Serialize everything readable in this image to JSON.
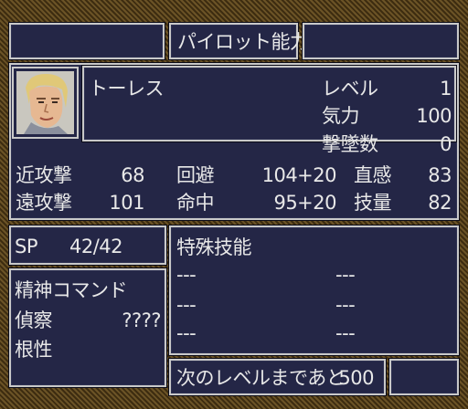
{
  "screen_title": "パイロット能力",
  "pilot": {
    "name": "トーレス",
    "level_label": "レベル",
    "level": "1",
    "kiryoku_label": "気力",
    "kiryoku": "100",
    "kills_label": "撃墜数",
    "kills": "0"
  },
  "stats": {
    "melee_label": "近攻撃",
    "melee": "68",
    "ranged_label": "遠攻撃",
    "ranged": "101",
    "evade_label": "回避",
    "evade": "104+20",
    "hit_label": "命中",
    "hit": "95+20",
    "intuition_label": "直感",
    "intuition": "83",
    "skill_label": "技量",
    "skill": "82"
  },
  "sp": {
    "label": "SP",
    "value": "42/42"
  },
  "spirit": {
    "title": "精神コマンド",
    "commands": [
      {
        "name": "偵察",
        "cost": "????"
      },
      {
        "name": "根性",
        "cost": ""
      }
    ]
  },
  "special_skills": {
    "title": "特殊技能",
    "slots": [
      "---",
      "---",
      "---",
      "---",
      "---",
      "---"
    ]
  },
  "next_level": {
    "label": "次のレベルまであと",
    "value": "500"
  },
  "colors": {
    "panel": "#242646",
    "border": "#c9c9c9",
    "text": "#e8e8e8",
    "frame": "#5a4420"
  },
  "icons": {
    "portrait": "pilot-portrait-torres"
  }
}
